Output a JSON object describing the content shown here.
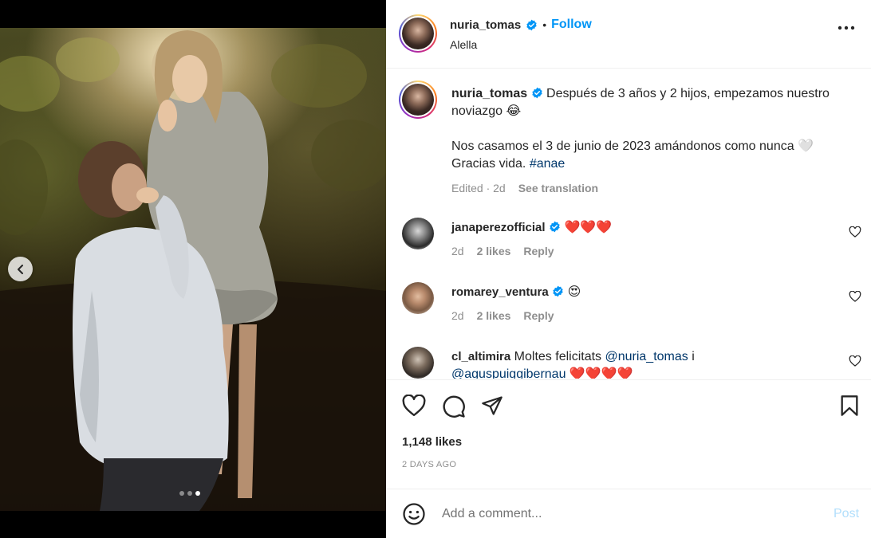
{
  "post": {
    "username": "nuria_tomas",
    "follow_label": "Follow",
    "separator": "•",
    "location": "Alella",
    "carousel": {
      "slide_count": 3,
      "active_slide": 3
    }
  },
  "caption": {
    "username": "nuria_tomas",
    "line1": "Después de 3 años y 2 hijos, empezamos nuestro noviazgo 😂",
    "line2": "Nos casamos el 3 de junio de 2023 amándonos como nunca 🤍",
    "line3_prefix": "Gracias vida. ",
    "hashtag": "#anae",
    "edited": "Edited · 2d",
    "see_translation": "See translation"
  },
  "comments": [
    {
      "username": "janaperezofficial",
      "text": "❤️❤️❤️",
      "age": "2d",
      "likes": "2 likes",
      "reply": "Reply"
    },
    {
      "username": "romarey_ventura",
      "text": "😍",
      "age": "2d",
      "likes": "2 likes",
      "reply": "Reply"
    },
    {
      "username": "cl_altimira",
      "text": "Moltes felicitats ",
      "mention1": "@nuria_tomas",
      "text2": " i",
      "mention2": "@aguspuiggibernau",
      "text3": " ❤️❤️❤️❤️"
    }
  ],
  "footer": {
    "likes": "1,148 likes",
    "time_ago": "2 DAYS AGO",
    "comment_placeholder": "Add a comment...",
    "post_label": "Post"
  },
  "colors": {
    "accent": "#0095f6",
    "post_disabled": "#b2dffc",
    "hashtag": "#00376b",
    "muted": "#8e8e8e"
  }
}
